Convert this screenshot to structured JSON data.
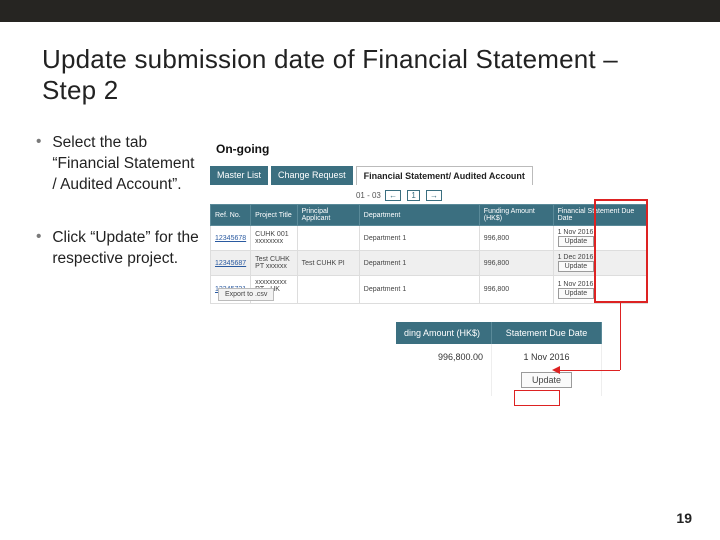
{
  "title": "Update submission date of Financial Statement – Step 2",
  "bullets": [
    "Select the tab “Financial Statement / Audited Account”.",
    "Click “Update” for the respective project."
  ],
  "screenshot1": {
    "heading": "On-going",
    "tabs": [
      "Master List",
      "Change Request",
      "Financial Statement/ Audited Account"
    ],
    "active_tab_index": 2,
    "pager_prefix": "01 - 03",
    "pager_arrow_left": "←",
    "pager_page": "1",
    "pager_arrow_right": "→",
    "columns": [
      "Ref. No.",
      "Project Title",
      "Principal Applicant",
      "Department",
      "Funding Amount (HK$)",
      "Financial Statement Due Date"
    ],
    "rows": [
      {
        "ref": "12345678",
        "title_line1": "CUHK 001",
        "title_line2": "xxxxxxxx",
        "pa": "",
        "dept": "Department 1",
        "amt": "996,800",
        "due": "1 Nov 2016",
        "alt": true
      },
      {
        "ref": "12345687",
        "title_line1": "Test CUHK",
        "title_line2": "PT xxxxxx",
        "pa": "Test CUHK PI",
        "dept": "Department 1",
        "amt": "996,800",
        "due": "1 Dec 2016",
        "alt": false
      },
      {
        "ref": "12345721",
        "title_line1": "xxxxxxxxx",
        "title_line2": "PT - HK 001",
        "pa": "",
        "dept": "Department 1",
        "amt": "996,800",
        "due": "1 Nov 2016",
        "alt": true
      }
    ],
    "update_label": "Update",
    "export_label": "Export to .csv"
  },
  "screenshot2": {
    "col_amount": "ding Amount (HK$)",
    "col_due": "Statement Due Date",
    "amount_value": "996,800.00",
    "due_value": "1 Nov 2016",
    "update_label": "Update"
  },
  "page_number": "19"
}
